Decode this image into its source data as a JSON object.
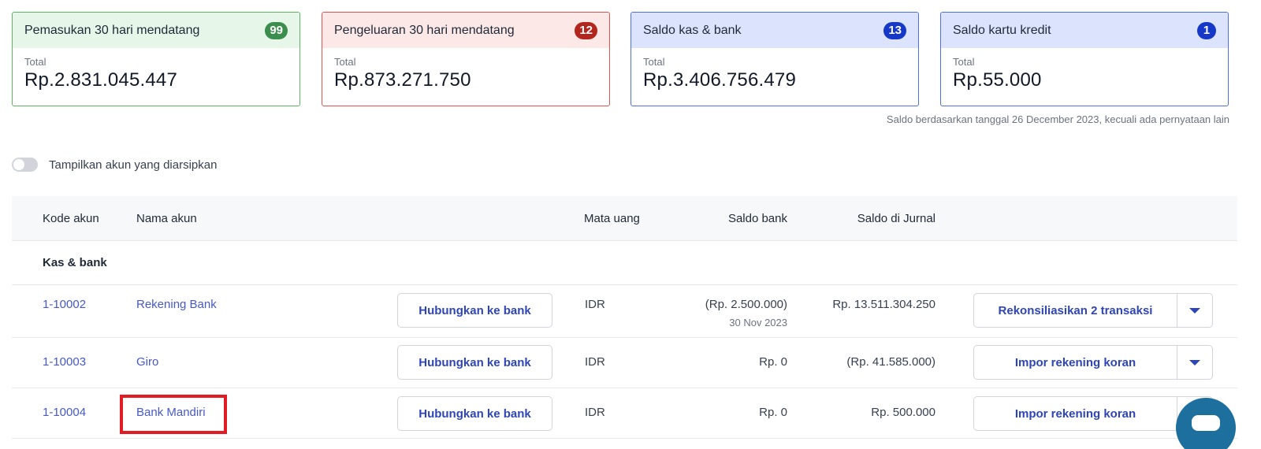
{
  "cards": [
    {
      "title": "Pemasukan 30 hari mendatang",
      "count": "99",
      "sub": "Total",
      "amount": "Rp.2.831.045.447",
      "color": "#3c8e4f"
    },
    {
      "title": "Pengeluaran 30 hari mendatang",
      "count": "12",
      "sub": "Total",
      "amount": "Rp.873.271.750",
      "color": "#b3261e"
    },
    {
      "title": "Saldo kas & bank",
      "count": "13",
      "sub": "Total",
      "amount": "Rp.3.406.756.479",
      "color": "#1638c9"
    },
    {
      "title": "Saldo kartu kredit",
      "count": "1",
      "sub": "Total",
      "amount": "Rp.55.000",
      "color": "#1638c9"
    }
  ],
  "balance_note": "Saldo berdasarkan tanggal 26 December 2023, kecuali ada pernyataan lain",
  "archive_toggle": {
    "label": "Tampilkan akun yang diarsipkan",
    "on": false
  },
  "table": {
    "headers": {
      "code": "Kode akun",
      "name": "Nama akun",
      "currency": "Mata uang",
      "bank_balance": "Saldo bank",
      "journal_balance": "Saldo di Jurnal"
    },
    "section": "Kas & bank",
    "rows": [
      {
        "code": "1-10002",
        "name": "Rekening Bank",
        "connect": "Hubungkan ke bank",
        "currency": "IDR",
        "bank_balance": "(Rp. 2.500.000)",
        "bank_date": "30 Nov 2023",
        "journal_balance": "Rp. 13.511.304.250",
        "action": "Rekonsiliasikan 2 transaksi"
      },
      {
        "code": "1-10003",
        "name": "Giro",
        "connect": "Hubungkan ke bank",
        "currency": "IDR",
        "bank_balance": "Rp. 0",
        "bank_date": "",
        "journal_balance": "(Rp. 41.585.000)",
        "action": "Impor rekening koran"
      },
      {
        "code": "1-10004",
        "name": "Bank Mandiri",
        "connect": "Hubungkan ke bank",
        "currency": "IDR",
        "bank_balance": "Rp. 0",
        "bank_date": "",
        "journal_balance": "Rp. 500.000",
        "action": "Impor rekening koran"
      }
    ]
  },
  "icons": {
    "dropdown": "chevron-down-icon",
    "chat": "chat-icon"
  },
  "highlight_color": "#e31b23"
}
